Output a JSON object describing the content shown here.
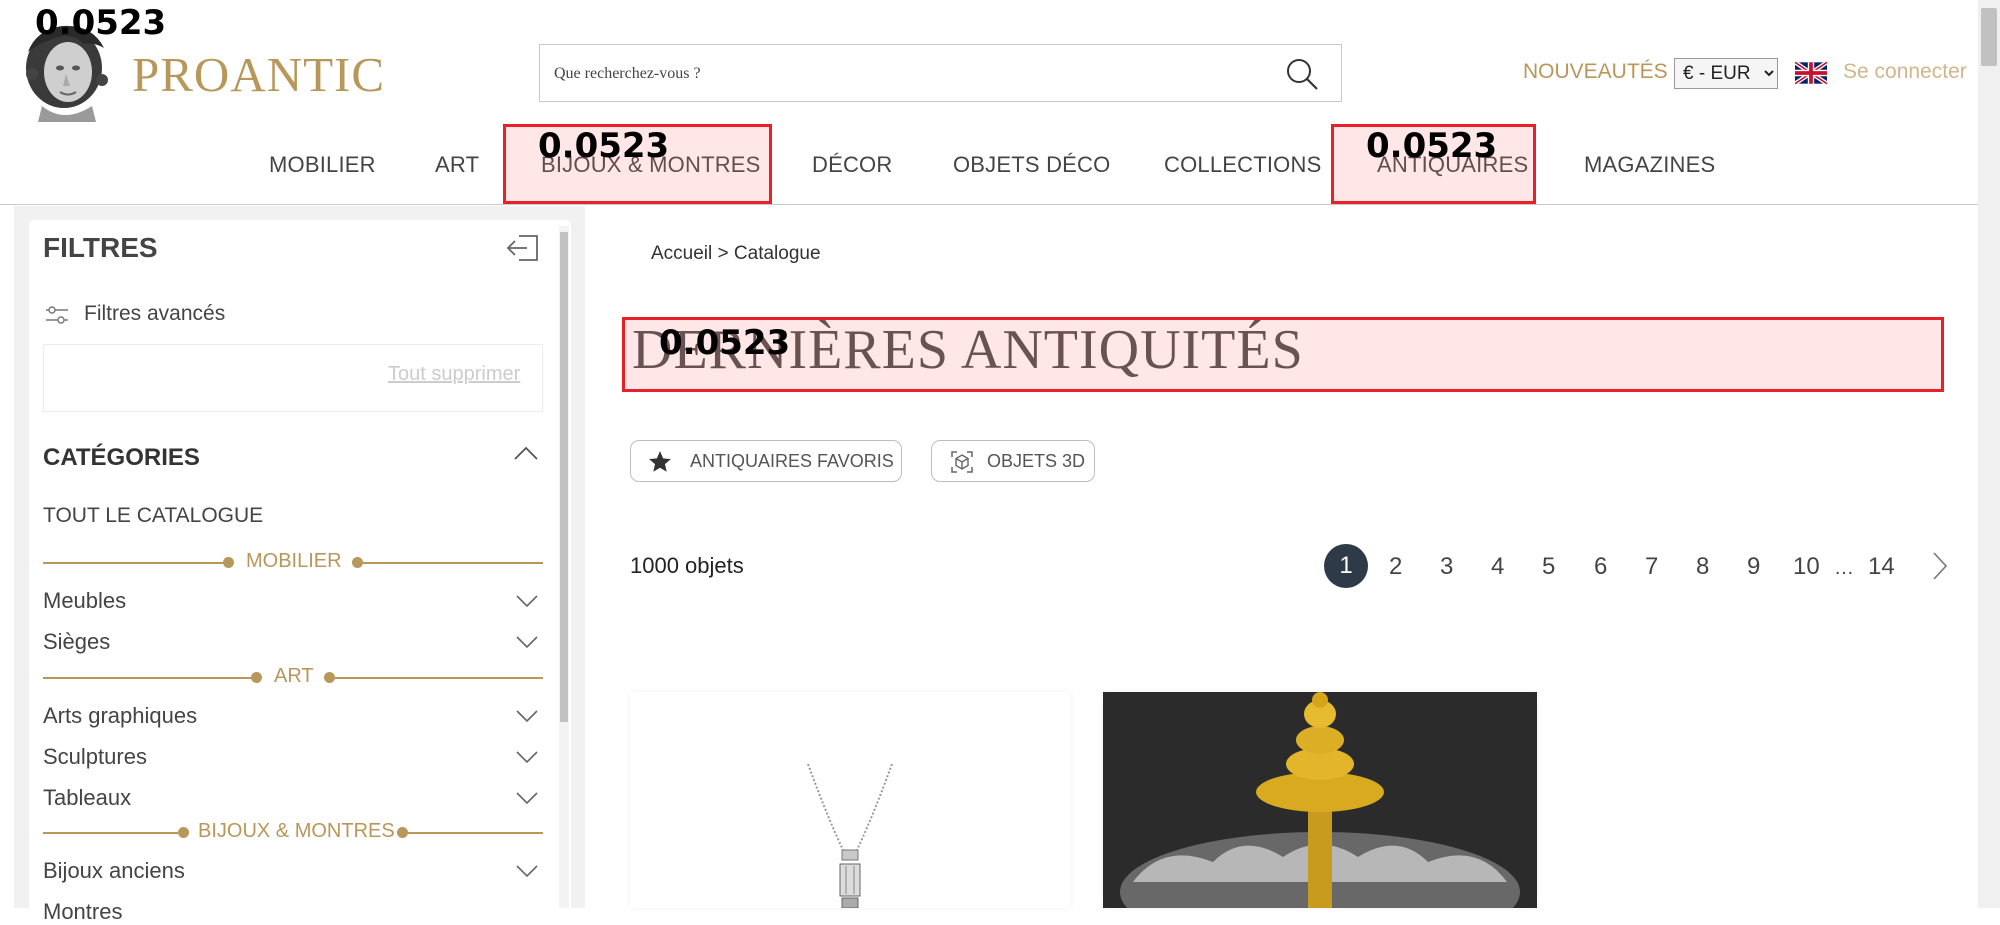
{
  "annotation_value": "0.0523",
  "header": {
    "brand": "PROANTIC",
    "search_placeholder": "Que recherchez-vous ?",
    "nouveautes": "NOUVEAUTÉS",
    "currency_options": [
      "€ - EUR"
    ],
    "login": "Se connecter"
  },
  "nav": {
    "items": [
      "MOBILIER",
      "ART",
      "BIJOUX & MONTRES",
      "DÉCOR",
      "OBJETS DÉCO",
      "COLLECTIONS",
      "ANTIQUAIRES",
      "MAGAZINES"
    ]
  },
  "sidebar": {
    "title": "FILTRES",
    "advanced_filters": "Filtres avancés",
    "clear_all": "Tout supprimer",
    "categories_title": "CATÉGORIES",
    "all_catalogue": "TOUT LE CATALOGUE",
    "sections": [
      {
        "label": "MOBILIER",
        "items": [
          "Meubles",
          "Sièges"
        ]
      },
      {
        "label": "ART",
        "items": [
          "Arts graphiques",
          "Sculptures",
          "Tableaux"
        ]
      },
      {
        "label": "BIJOUX & MONTRES",
        "items": [
          "Bijoux anciens",
          "Montres"
        ]
      }
    ]
  },
  "main": {
    "breadcrumb": "Accueil > Catalogue",
    "title": "DERNIÈRES ANTIQUITÉS",
    "chips": [
      "ANTIQUAIRES FAVORIS",
      "OBJETS 3D"
    ],
    "count": "1000 objets",
    "pagination": {
      "active": "1",
      "pages": [
        "2",
        "3",
        "4",
        "5",
        "6",
        "7",
        "8",
        "9",
        "10"
      ],
      "ellipsis": "…",
      "last": "14"
    }
  },
  "colors": {
    "brand_gold": "#b8975b",
    "annotation_red": "#e8202a",
    "pagination_active": "#2f3a49"
  }
}
